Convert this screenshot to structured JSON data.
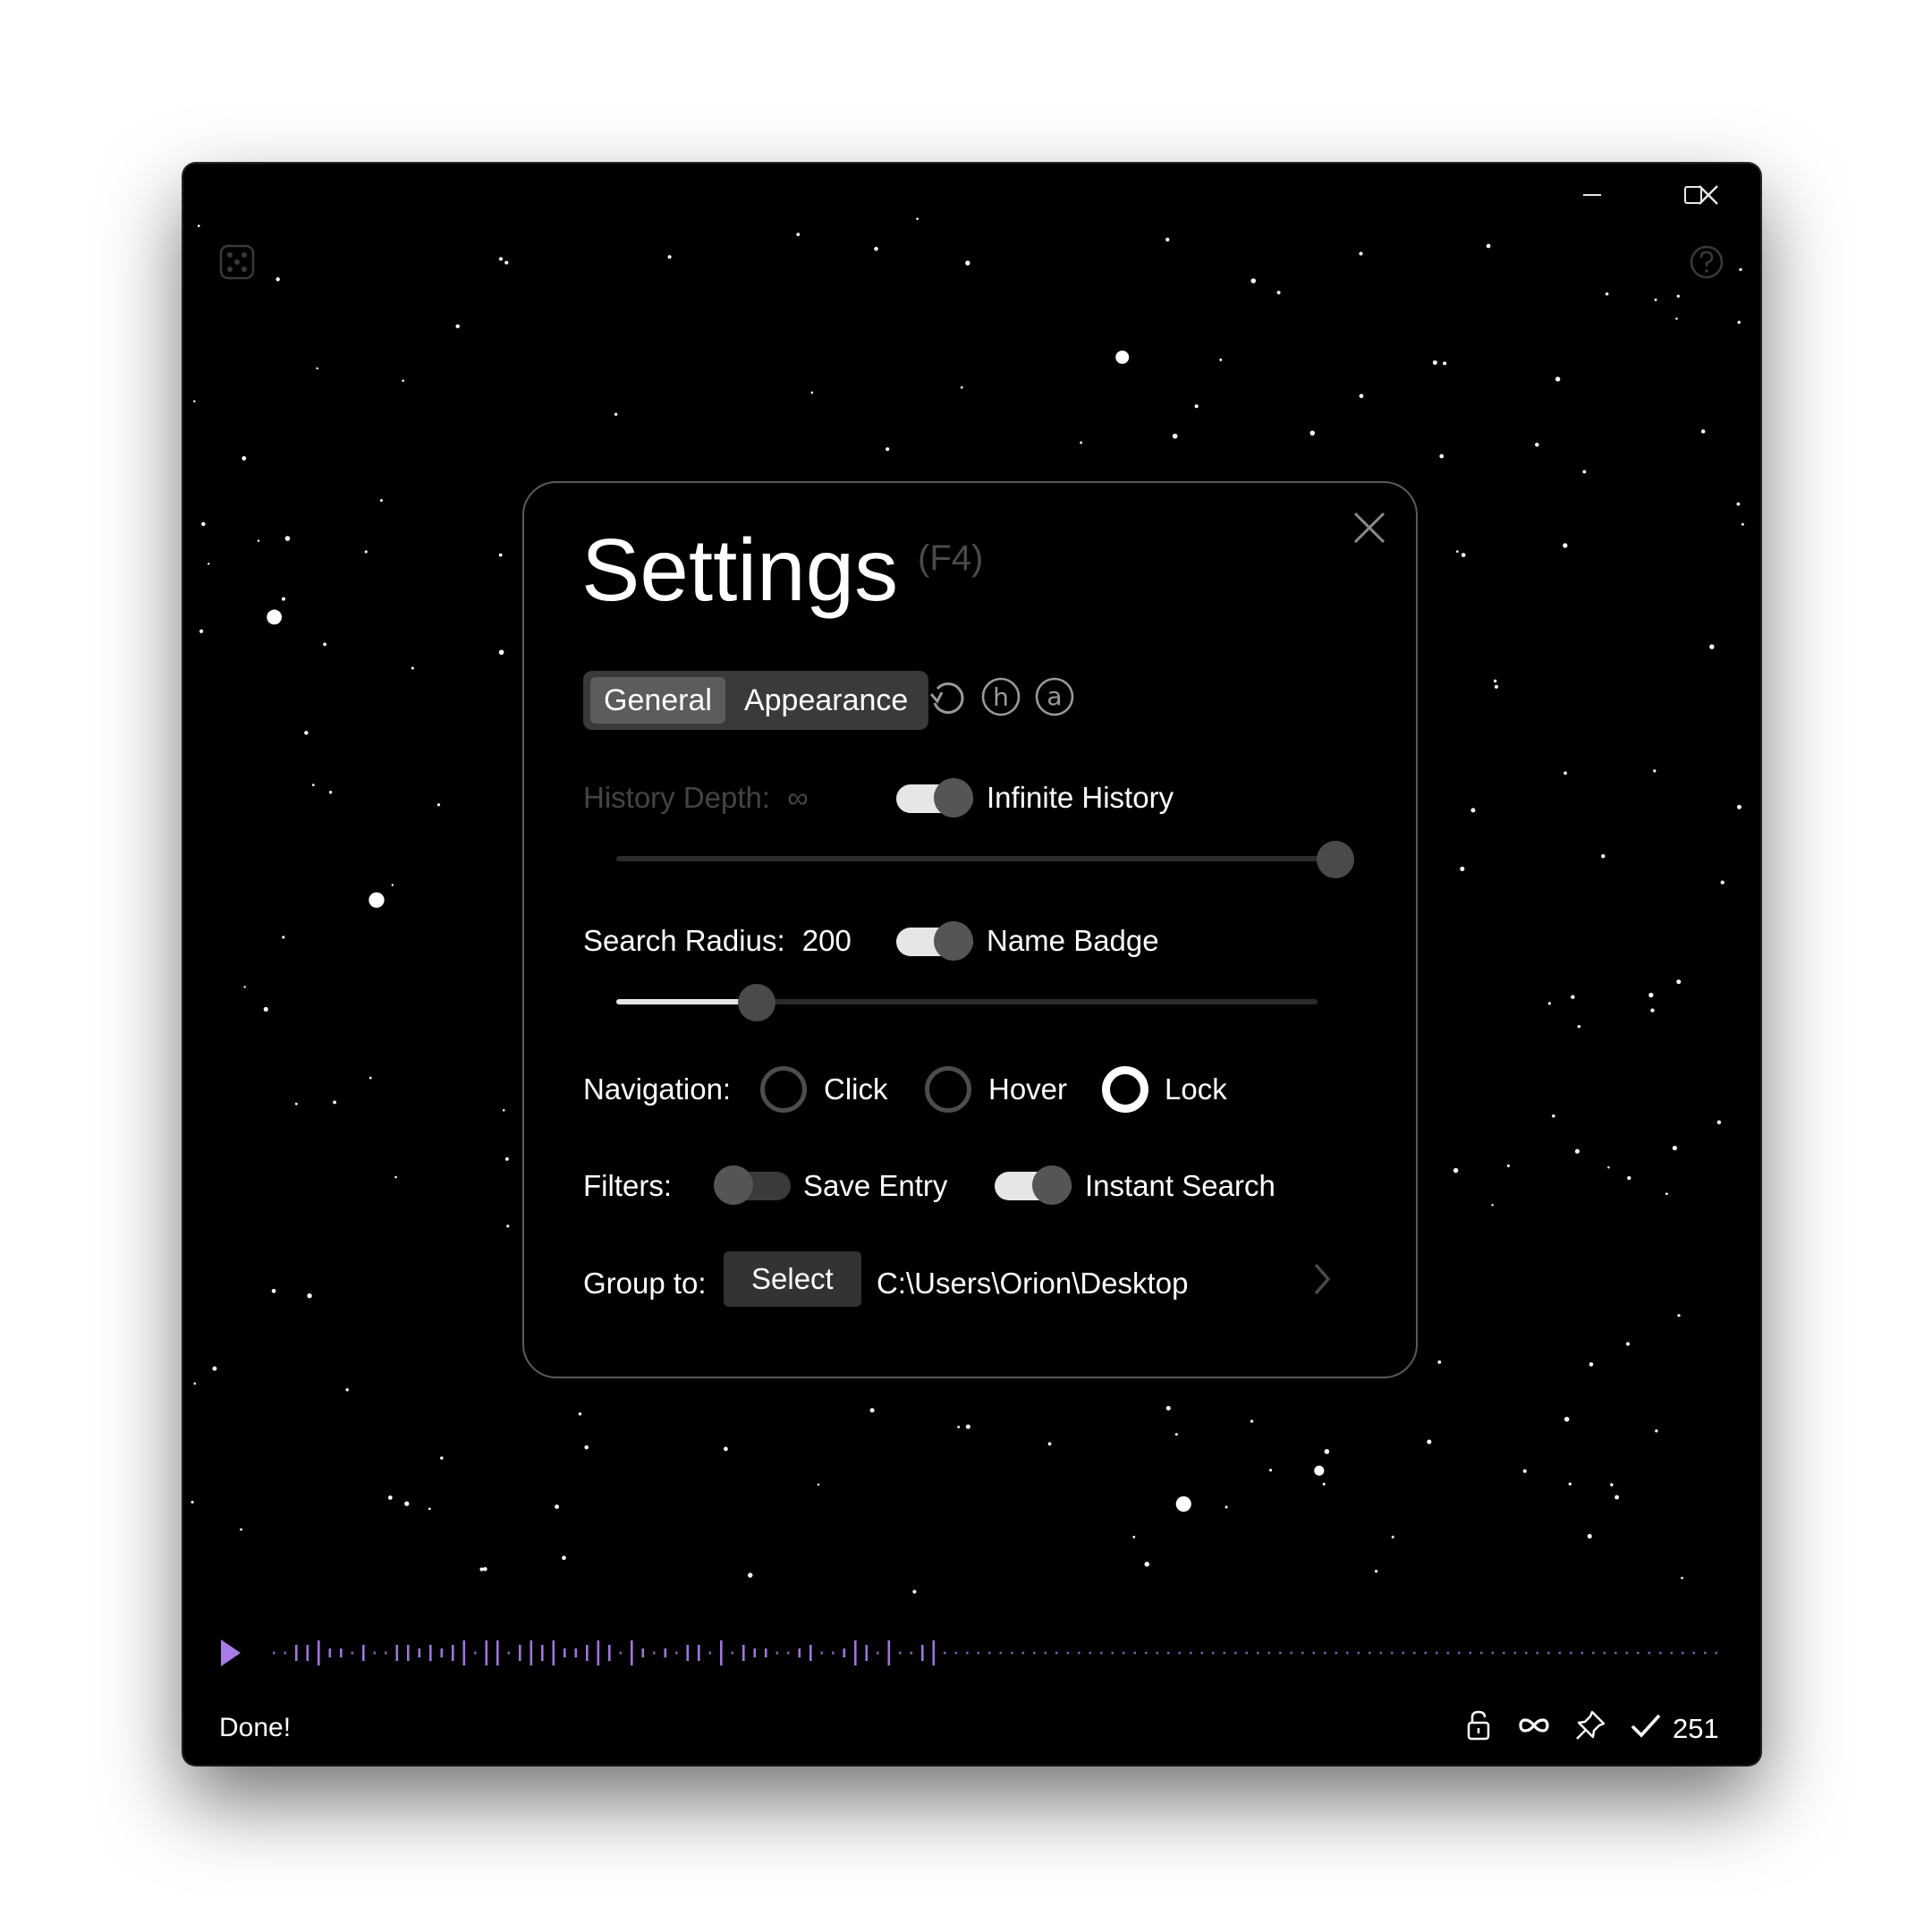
{
  "window": {
    "caption": {
      "minimize_icon": "minimize-icon",
      "maximize_icon": "maximize-icon",
      "close_icon": "close-icon"
    },
    "left_corner_icon": "dice-icon",
    "right_corner_icon": "help-icon"
  },
  "settings": {
    "title": "Settings",
    "shortcut": "(F4)",
    "tabs": [
      {
        "label": "General",
        "active": true
      },
      {
        "label": "Appearance",
        "active": false
      }
    ],
    "tools": [
      "undo-icon",
      "h-circle-icon",
      "a-circle-icon"
    ],
    "history": {
      "label": "History Depth:",
      "value": "∞",
      "toggle_label": "Infinite History",
      "toggle_on": true,
      "slider_fraction": 1.0
    },
    "search": {
      "label": "Search Radius:",
      "value": "200",
      "toggle_label": "Name Badge",
      "toggle_on": true,
      "slider_fraction": 0.2
    },
    "navigation": {
      "label": "Navigation:",
      "options": [
        {
          "label": "Click",
          "selected": false
        },
        {
          "label": "Hover",
          "selected": false
        },
        {
          "label": "Lock",
          "selected": true
        }
      ]
    },
    "filters": {
      "label": "Filters:",
      "save_entry": {
        "label": "Save Entry",
        "on": false
      },
      "instant_search": {
        "label": "Instant Search",
        "on": true
      }
    },
    "group": {
      "label": "Group to:",
      "button": "Select",
      "path": "C:\\Users\\Orion\\Desktop"
    }
  },
  "timeline": {
    "accent": "#a87be8",
    "play_icon": "play-icon"
  },
  "statusbar": {
    "status": "Done!",
    "icons": [
      "lock-icon",
      "infinity-icon",
      "pin-icon",
      "check-icon"
    ],
    "count": "251"
  },
  "colors": {
    "background": "#000000",
    "text": "#ffffff",
    "accent": "#a87be8"
  }
}
